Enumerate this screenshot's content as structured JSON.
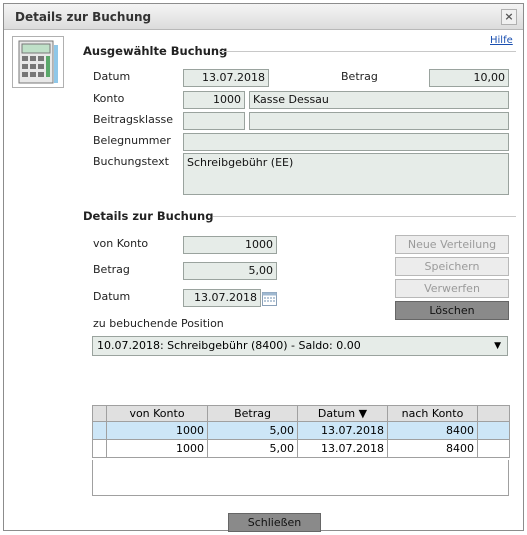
{
  "window": {
    "title": "Details zur Buchung",
    "close_symbol": "×",
    "help_label": "Hilfe"
  },
  "selected_booking": {
    "section_title": "Ausgewählte Buchung",
    "date_label": "Datum",
    "date_value": "13.07.2018",
    "amount_label": "Betrag",
    "amount_value": "10,00",
    "account_label": "Konto",
    "account_number": "1000",
    "account_name": "Kasse Dessau",
    "contribution_class_label": "Beitragsklasse",
    "contribution_class_code": "",
    "contribution_class_name": "",
    "receipt_label": "Belegnummer",
    "receipt_value": "",
    "text_label": "Buchungstext",
    "text_value": "Schreibgebühr (EE)"
  },
  "booking_details": {
    "section_title": "Details zur Buchung",
    "from_account_label": "von Konto",
    "from_account_value": "1000",
    "amount_label": "Betrag",
    "amount_value": "5,00",
    "date_label": "Datum",
    "date_value": "13.07.2018",
    "position_label": "zu bebuchende Position",
    "position_value": "10.07.2018: Schreibgebühr (8400) - Saldo: 0.00",
    "position_arrow": "▼"
  },
  "buttons": {
    "new_distribution": "Neue Verteilung",
    "save": "Speichern",
    "discard": "Verwerfen",
    "delete": "Löschen",
    "close": "Schließen"
  },
  "table": {
    "columns": [
      "von Konto",
      "Betrag",
      "Datum ▼",
      "nach Konto"
    ],
    "rows": [
      [
        "1000",
        "5,00",
        "13.07.2018",
        "8400"
      ],
      [
        "1000",
        "5,00",
        "13.07.2018",
        "8400"
      ]
    ]
  },
  "colors": {
    "field_bg": "#e6ece8",
    "selected_row": "#cde6f7",
    "active_button": "#8a8a8a",
    "link": "#1a4fb0"
  },
  "icons": [
    "calculator-icon",
    "calendar-icon",
    "close-icon",
    "dropdown-arrow-icon"
  ]
}
